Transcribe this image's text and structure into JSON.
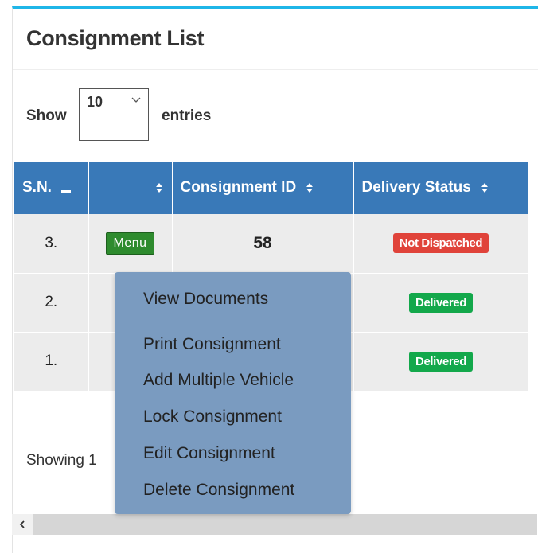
{
  "panel": {
    "title": "Consignment List"
  },
  "length_control": {
    "show_label": "Show",
    "selected": "10",
    "entries_label": "entries"
  },
  "table": {
    "headers": {
      "sn": "S.N.",
      "action": "",
      "consignment_id": "Consignment ID",
      "delivery_status": "Delivery Status"
    },
    "rows": [
      {
        "sn": "3.",
        "action_label": "Menu",
        "consignment_id": "58",
        "status": "Not Dispatched",
        "status_color": "#e0433a"
      },
      {
        "sn": "2.",
        "action_label": "",
        "consignment_id": "",
        "status": "Delivered",
        "status_color": "#13a84b"
      },
      {
        "sn": "1.",
        "action_label": "",
        "consignment_id": "",
        "status": "Delivered",
        "status_color": "#13a84b"
      }
    ]
  },
  "footer": {
    "info": "Showing 1"
  },
  "dropdown_menu": {
    "items": [
      "View Documents",
      "Print Consignment",
      "Add Multiple Vehicle",
      "Lock Consignment",
      "Edit Consignment",
      "Delete Consignment"
    ]
  },
  "colors": {
    "accent_top_border": "#1fb6e8",
    "table_header": "#3979b8",
    "menu_button": "#2e8b2e",
    "dropdown_bg": "#7a9bc0"
  },
  "icons": {
    "sort_desc": "sort-desc-icon",
    "sort_both": "sort-both-icon",
    "select_chevron": "chevron-down-icon",
    "scroll_left": "chevron-left-icon"
  }
}
